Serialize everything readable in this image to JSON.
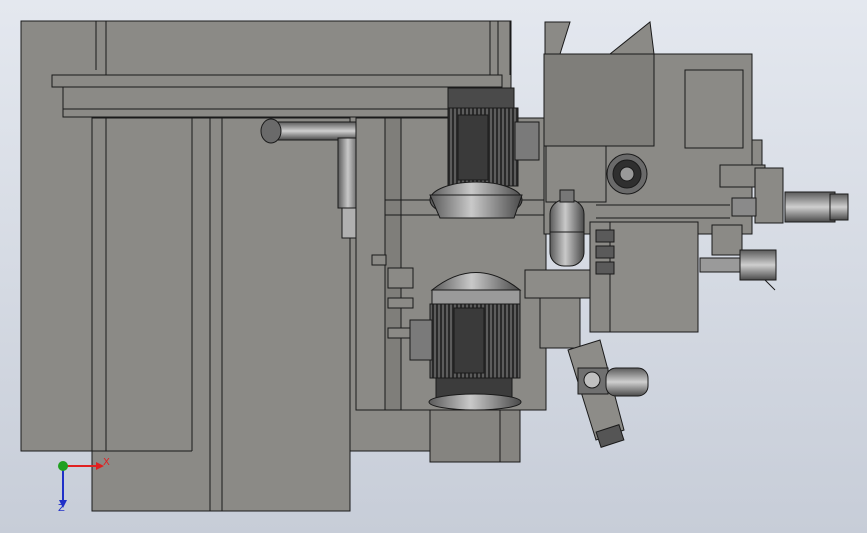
{
  "viewport": {
    "background_top": "#e4e8ef",
    "background_bottom": "#c7cdd8"
  },
  "palette": {
    "body_fill": "#8b8a86",
    "body_stroke": "#1a1a1a",
    "motor_dark": "#3c3c3c",
    "motor_mid": "#6f6f6f",
    "motor_light": "#b8b8b8"
  },
  "triad": {
    "x_label": "X",
    "z_label": "Z",
    "x_color": "#e02020",
    "y_color": "#20a020",
    "z_color": "#2030c8"
  }
}
